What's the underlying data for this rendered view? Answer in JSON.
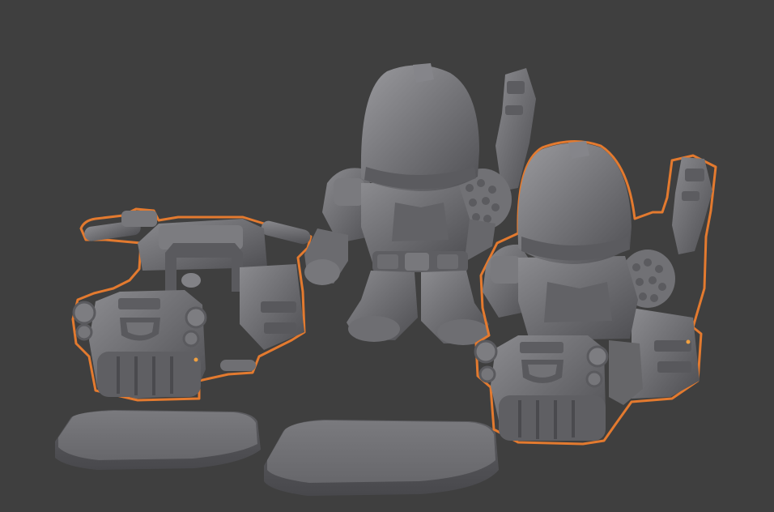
{
  "app": {
    "name": "3D viewport",
    "background": "#3f3f3f",
    "mesh_color": "#6b6b6f",
    "mesh_shadow": "#4a4a4e",
    "mesh_highlight": "#8a8a8e",
    "selection_outline": "#e37a2f",
    "origin_dot": "#f0a040"
  },
  "scene": {
    "objects": [
      {
        "name": "hoverbike",
        "selected": true
      },
      {
        "name": "soldier-figure",
        "selected": false
      },
      {
        "name": "soldier-on-hoverbike",
        "selected": true
      },
      {
        "name": "base-left",
        "selected": false
      },
      {
        "name": "base-center",
        "selected": false
      }
    ]
  }
}
